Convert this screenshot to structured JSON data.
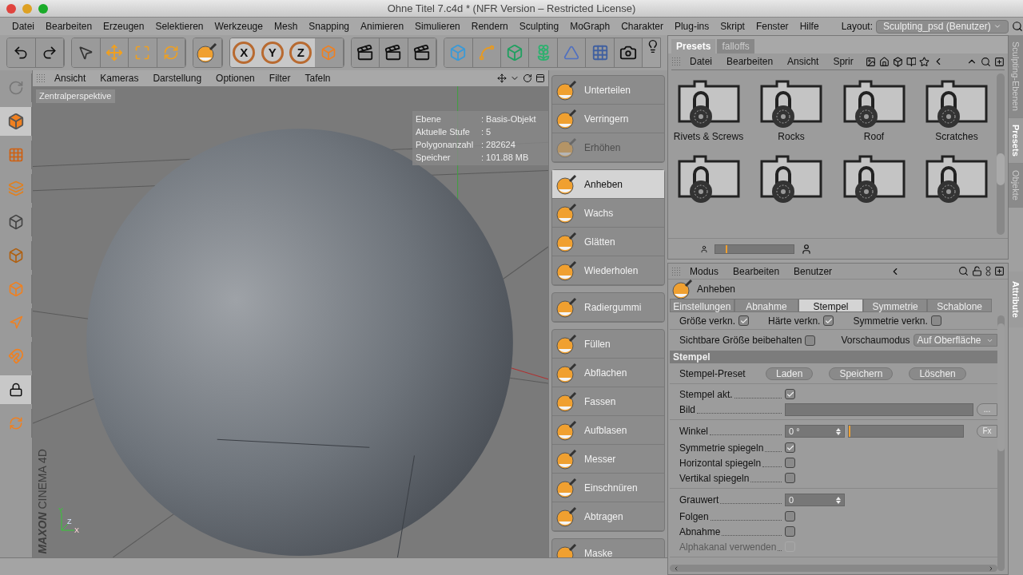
{
  "window": {
    "title": "Ohne Titel 7.c4d * (NFR Version – Restricted License)"
  },
  "menu_bar": {
    "items": [
      "Datei",
      "Bearbeiten",
      "Erzeugen",
      "Selektieren",
      "Werkzeuge",
      "Mesh",
      "Snapping",
      "Animieren",
      "Simulieren",
      "Rendern",
      "Sculpting",
      "MoGraph",
      "Charakter",
      "Plug-ins",
      "Skript",
      "Fenster",
      "Hilfe"
    ],
    "layout_label": "Layout:",
    "layout_value": "Sculpting_psd (Benutzer)"
  },
  "toolbar": {
    "axis_buttons": [
      {
        "label": "X",
        "on": true
      },
      {
        "label": "Y",
        "on": true
      },
      {
        "label": "Z",
        "on": true
      }
    ]
  },
  "viewport": {
    "menu": [
      "Ansicht",
      "Kameras",
      "Darstellung",
      "Optionen",
      "Filter",
      "Tafeln"
    ],
    "camera": "Zentralperspektive",
    "info": [
      {
        "label": "Ebene",
        "value": ": Basis-Objekt"
      },
      {
        "label": "Aktuelle Stufe",
        "value": ": 5"
      },
      {
        "label": "Polygonanzahl",
        "value": ": 282624"
      },
      {
        "label": "Speicher",
        "value": ": 101.88 MB"
      }
    ],
    "axes": [
      "Y",
      "Z",
      "X"
    ],
    "brand": [
      "MAXON",
      "CINEMA 4D"
    ]
  },
  "tools": [
    [
      {
        "label": "Unterteilen",
        "selected": false,
        "disabled": false
      },
      {
        "label": "Verringern",
        "selected": false,
        "disabled": false
      },
      {
        "label": "Erhöhen",
        "selected": false,
        "disabled": true
      }
    ],
    [
      {
        "label": "Anheben",
        "selected": true,
        "disabled": false
      },
      {
        "label": "Wachs",
        "selected": false,
        "disabled": false
      },
      {
        "label": "Glätten",
        "selected": false,
        "disabled": false
      },
      {
        "label": "Wiederholen",
        "selected": false,
        "disabled": false
      }
    ],
    [
      {
        "label": "Radiergummi",
        "selected": false,
        "disabled": false
      }
    ],
    [
      {
        "label": "Füllen",
        "selected": false,
        "disabled": false
      },
      {
        "label": "Abflachen",
        "selected": false,
        "disabled": false
      },
      {
        "label": "Fassen",
        "selected": false,
        "disabled": false
      },
      {
        "label": "Aufblasen",
        "selected": false,
        "disabled": false
      },
      {
        "label": "Messer",
        "selected": false,
        "disabled": false
      },
      {
        "label": "Einschnüren",
        "selected": false,
        "disabled": false
      },
      {
        "label": "Abtragen",
        "selected": false,
        "disabled": false
      }
    ],
    [
      {
        "label": "Maske",
        "selected": false,
        "disabled": false
      }
    ]
  ],
  "presets": {
    "tabs": [
      {
        "label": "Presets",
        "selected": true
      },
      {
        "label": "falloffs",
        "selected": false
      }
    ],
    "menu": [
      "Datei",
      "Bearbeiten",
      "Ansicht",
      "Sprir"
    ],
    "items": [
      {
        "kind": "locked-folder",
        "label": "Rivets & Screws"
      },
      {
        "kind": "locked-folder",
        "label": "Rocks"
      },
      {
        "kind": "locked-folder",
        "label": "Roof"
      },
      {
        "kind": "locked-folder",
        "label": "Scratches"
      },
      {
        "kind": "locked-folder"
      },
      {
        "kind": "locked-folder"
      },
      {
        "kind": "locked-folder"
      },
      {
        "kind": "locked-folder"
      }
    ],
    "zoom": {
      "level": 0.15
    }
  },
  "side_tabs": [
    {
      "label": "Sculpting-Ebenen",
      "selected": false
    },
    {
      "label": "Presets",
      "selected": true
    },
    {
      "label": "Objekte",
      "selected": false
    }
  ],
  "attributes": {
    "menu": [
      "Modus",
      "Bearbeiten",
      "Benutzer"
    ],
    "side_tab": "Attribute",
    "title": "Anheben",
    "tabs": [
      {
        "label": "Einstellungen",
        "selected": false
      },
      {
        "label": "Abnahme",
        "selected": false
      },
      {
        "label": "Stempel",
        "selected": true
      },
      {
        "label": "Symmetrie",
        "selected": false
      },
      {
        "label": "Schablone",
        "selected": false
      }
    ],
    "options": [
      {
        "label": "Größe verkn.",
        "checked": true
      },
      {
        "label": "Härte verkn.",
        "checked": true
      },
      {
        "label": "Symmetrie verkn.",
        "checked": false
      }
    ],
    "keep_size": {
      "label": "Sichtbare Größe beibehalten",
      "checked": false
    },
    "preview": {
      "label": "Vorschaumodus",
      "value": "Auf Oberfläche"
    },
    "section": "Stempel",
    "preset_label": "Stempel-Preset",
    "preset_buttons": [
      "Laden",
      "Speichern",
      "Löschen"
    ],
    "groups": [
      [
        {
          "kind": "checkbox",
          "label": "Stempel akt.",
          "checked": true,
          "disabled": false
        },
        {
          "kind": "image",
          "label": "Bild",
          "button": "..."
        }
      ],
      [
        {
          "kind": "slider",
          "label": "Winkel",
          "value": "0 °",
          "level": 0,
          "button": "Fx"
        },
        {
          "kind": "checkbox",
          "label": "Symmetrie spiegeln",
          "checked": true,
          "disabled": false
        },
        {
          "kind": "checkbox",
          "label": "Horizontal spiegeln",
          "checked": false,
          "disabled": false
        },
        {
          "kind": "checkbox",
          "label": "Vertikal spiegeln",
          "checked": false,
          "disabled": false
        }
      ],
      [
        {
          "kind": "number",
          "label": "Grauwert",
          "value": "0"
        },
        {
          "kind": "checkbox",
          "label": "Folgen",
          "checked": false,
          "disabled": false
        },
        {
          "kind": "checkbox",
          "label": "Abnahme",
          "checked": false,
          "disabled": false
        },
        {
          "kind": "checkbox",
          "label": "Alphakanal verwenden",
          "checked": false,
          "disabled": true
        }
      ]
    ]
  }
}
